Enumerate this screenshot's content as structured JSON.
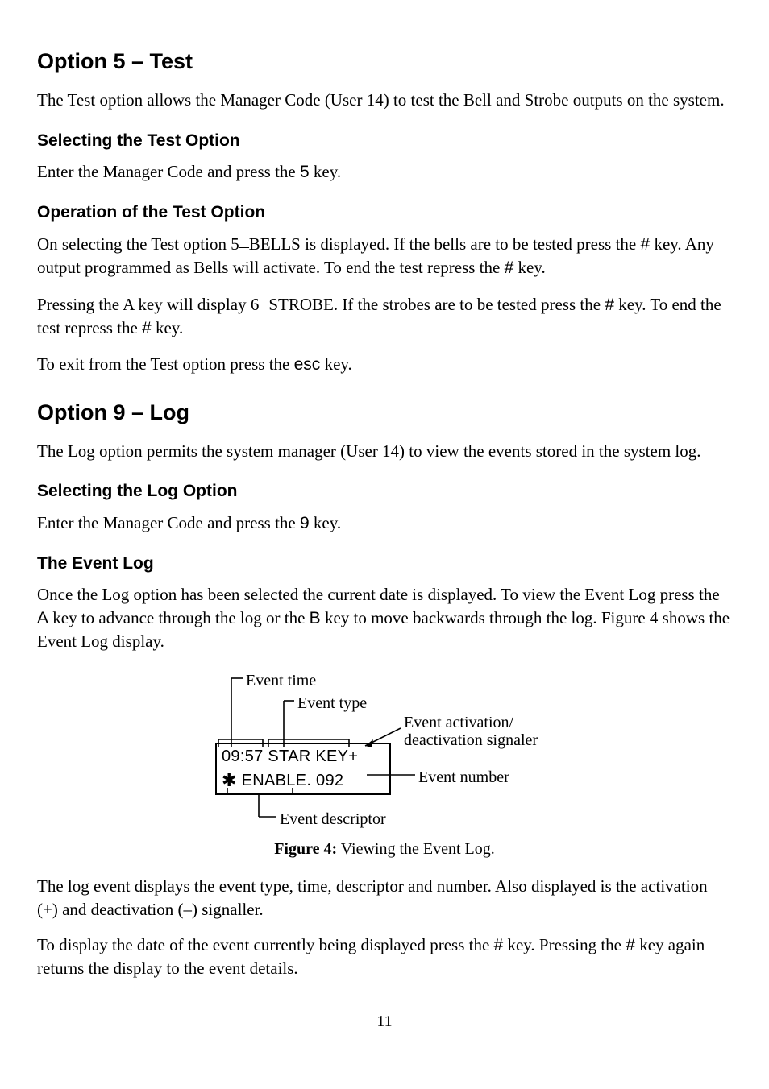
{
  "section5": {
    "heading": "Option 5 – Test",
    "intro": "The Test option allows the Manager Code (User 14) to test the Bell and Strobe outputs on the system.",
    "sub1_heading": "Selecting the Test Option",
    "sub1_text_a": "Enter the Manager Code and press the ",
    "sub1_key": "5",
    "sub1_text_b": " key.",
    "sub2_heading": "Operation of the Test Option",
    "sub2_p1_a": "On selecting the Test option  5",
    "sub2_p1_blank": "_",
    "sub2_p1_b": "BELLS is displayed. If the bells are to be tested press the ",
    "sub2_p1_hash1": "#",
    "sub2_p1_c": " key. Any output programmed as Bells will activate. To end the test repress the ",
    "sub2_p1_hash2": "#",
    "sub2_p1_d": " key.",
    "sub2_p2_a": "Pressing the A key will display 6",
    "sub2_p2_blank": "_",
    "sub2_p2_b": "STROBE. If the strobes are to be tested press the ",
    "sub2_p2_hash1": "#",
    "sub2_p2_c": " key. To end the test repress the ",
    "sub2_p2_hash2": "#",
    "sub2_p2_d": " key.",
    "sub2_p3_a": "To exit from the Test option press the ",
    "sub2_p3_esc": "esc",
    "sub2_p3_b": " key."
  },
  "section9": {
    "heading": "Option 9 – Log",
    "intro": "The Log option permits the system manager (User 14) to view the events stored in the system log.",
    "sub1_heading": "Selecting the Log Option",
    "sub1_text_a": "Enter the Manager Code and press the ",
    "sub1_key": "9",
    "sub1_text_b": " key.",
    "sub2_heading": "The Event Log",
    "sub2_p1_a": "Once the Log option has been selected the current date is displayed. To view the Event Log press the ",
    "sub2_p1_A": "A",
    "sub2_p1_b": " key to advance through the log or the ",
    "sub2_p1_B": "B",
    "sub2_p1_c": " key to move backwards through the log. Figure 4 shows the Event Log display."
  },
  "diagram": {
    "lcd_line1": "09:57 STAR KEY+",
    "lcd_line2_star": "✱",
    "lcd_line2_text": " ENABLE.   092",
    "label_time": "Event time",
    "label_type": "Event  type",
    "label_signal_a": "Event activation/",
    "label_signal_b": "deactivation signaler",
    "label_number": "Event number",
    "label_descriptor": "Event  descriptor"
  },
  "figure": {
    "label": "Figure 4:",
    "caption": " Viewing the Event Log."
  },
  "after": {
    "p1": "The log event displays the event type, time, descriptor and number. Also displayed is the activation (+) and deactivation (–) signaller.",
    "p2_a": "To display the date of the event currently being displayed press the ",
    "p2_hash1": "#",
    "p2_b": " key. Pressing the ",
    "p2_hash2": "#",
    "p2_c": " key again returns the display to the event details."
  },
  "page_number": "11"
}
